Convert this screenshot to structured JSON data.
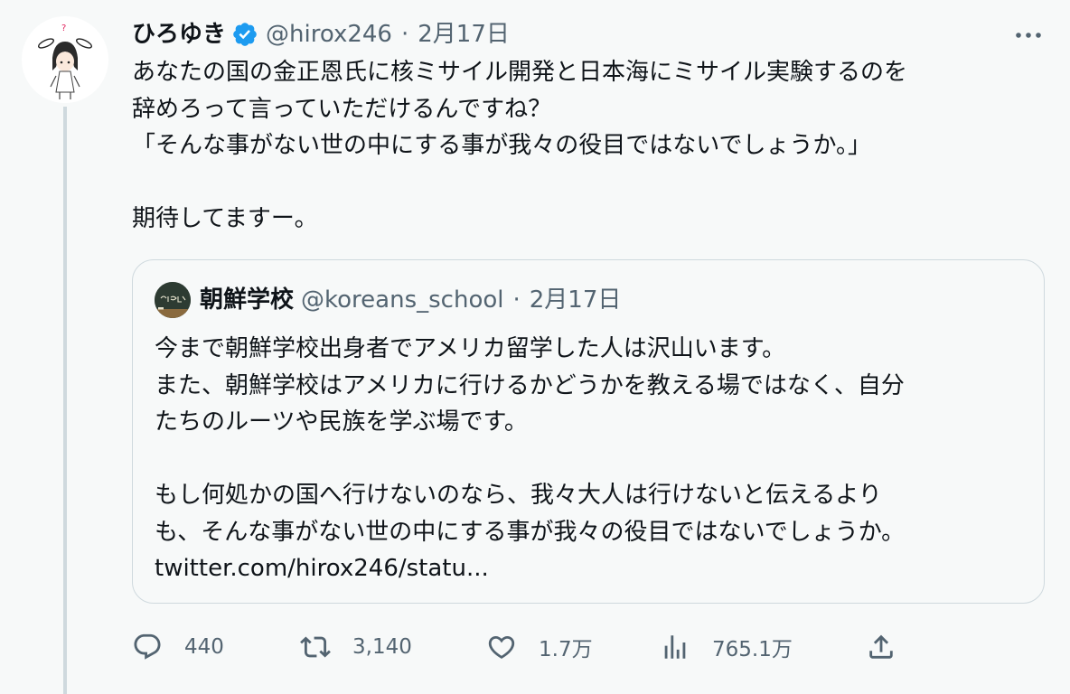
{
  "tweet": {
    "author": {
      "display_name": "ひろゆき",
      "handle": "@hirox246",
      "verified": true,
      "avatar_icon": "bunny-girl-avatar"
    },
    "separator": "·",
    "date": "2月17日",
    "more_icon": "more-horizontal-icon",
    "text": "あなたの国の金正恩氏に核ミサイル開発と日本海にミサイル実験するのを\n辞めろって言っていただけるんですね？\n「そんな事がない世の中にする事が我々の役目ではないでしょうか。」\n\n期待してますー。"
  },
  "quoted": {
    "author": {
      "display_name": "朝鮮学校",
      "handle": "@koreans_school",
      "avatar_icon": "chalkboard-avatar"
    },
    "separator": "·",
    "date": "2月17日",
    "text": "今まで朝鮮学校出身者でアメリカ留学した人は沢山います。\nまた、朝鮮学校はアメリカに行けるかどうかを教える場ではなく、自分\nたちのルーツや民族を学ぶ場です。\n\nもし何処かの国へ行けないのなら、我々大人は行けないと伝えるより\nも、そんな事がない世の中にする事が我々の役目ではないでしょうか。\ntwitter.com/hirox246/statu..."
  },
  "actions": {
    "reply_count": "440",
    "retweet_count": "3,140",
    "like_count": "1.7万",
    "view_count": "765.1万"
  },
  "colors": {
    "text": "#0f1419",
    "secondary": "#536471",
    "verified": "#1d9bf0",
    "border": "#cfd9de",
    "background": "#f7f9f9"
  }
}
